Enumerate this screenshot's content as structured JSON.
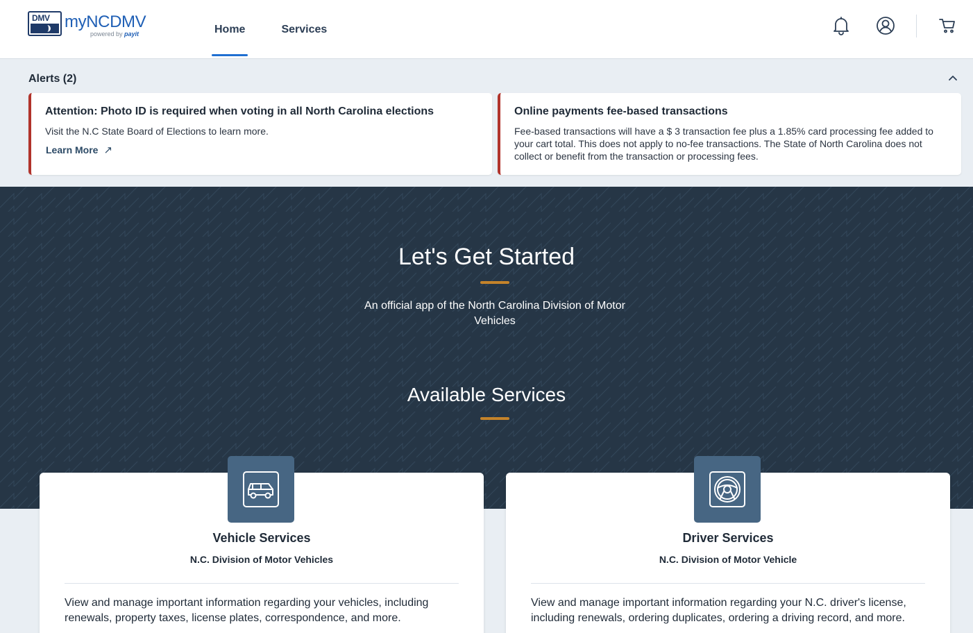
{
  "header": {
    "logo": {
      "badge": "DMV",
      "title_my": "my",
      "title_main": "NCDMV",
      "powered_by": "powered by",
      "brand": "payit"
    },
    "nav": [
      {
        "label": "Home",
        "active": true
      },
      {
        "label": "Services",
        "active": false
      }
    ],
    "icons": [
      "bell-icon",
      "account-icon",
      "cart-icon"
    ]
  },
  "alerts": {
    "title": "Alerts (2)",
    "items": [
      {
        "title": "Attention: Photo ID is required when voting in all North Carolina elections",
        "body": "Visit the N.C State Board of Elections to learn more.",
        "link": "Learn More",
        "accent": "#b1332b"
      },
      {
        "title": "Online payments fee-based transactions",
        "body": "Fee-based transactions will have a $ 3 transaction fee plus a 1.85% card processing fee added to your cart total. This does not apply to no-fee transactions. The State of North Carolina does not collect or benefit from the transaction or processing fees.",
        "accent": "#b1332b"
      }
    ]
  },
  "hero": {
    "title": "Let's Get Started",
    "subtitle": "An official app of the North Carolina Division of Motor Vehicles",
    "services_title": "Available Services",
    "accent": "#c4832a",
    "background": "#263646"
  },
  "services": [
    {
      "icon": "car-icon",
      "title": "Vehicle Services",
      "org": "N.C. Division of Motor Vehicles",
      "description": "View and manage important information regarding your vehicles, including renewals, property taxes, license plates, correspondence, and more."
    },
    {
      "icon": "steering-wheel-icon",
      "title": "Driver Services",
      "org": "N.C. Division of Motor Vehicle",
      "description": "View and manage important information regarding your N.C. driver's license, including renewals, ordering duplicates, ordering a driving record, and more."
    }
  ]
}
